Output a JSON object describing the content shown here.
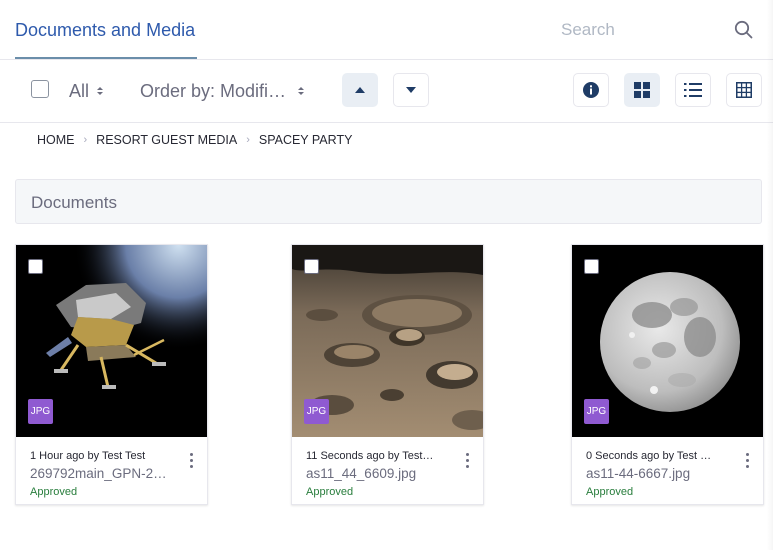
{
  "header": {
    "title": "Documents and Media",
    "search_placeholder": "Search"
  },
  "toolbar": {
    "filter_label": "All",
    "order_label": "Order by: Modifi…",
    "view_icons": [
      "info-icon",
      "cards-view-icon",
      "list-view-icon",
      "table-view-icon"
    ],
    "active_view": "cards"
  },
  "breadcrumb": [
    "HOME",
    "RESORT GUEST MEDIA",
    "SPACEY PARTY"
  ],
  "section": {
    "title": "Documents"
  },
  "cards": [
    {
      "badge": "JPG",
      "meta": "1 Hour ago by Test Test",
      "name": "269792main_GPN-2…",
      "status": "Approved",
      "image": "lunar-module-photo"
    },
    {
      "badge": "JPG",
      "meta": "11 Seconds ago by Test…",
      "name": "as11_44_6609.jpg",
      "status": "Approved",
      "image": "moon-surface-photo"
    },
    {
      "badge": "JPG",
      "meta": "0 Seconds ago by Test …",
      "name": "as11-44-6667.jpg",
      "status": "Approved",
      "image": "full-moon-photo"
    }
  ],
  "colors": {
    "accent": "#2e5aac",
    "badge": "#8f5ad1",
    "approved": "#287d3c"
  }
}
